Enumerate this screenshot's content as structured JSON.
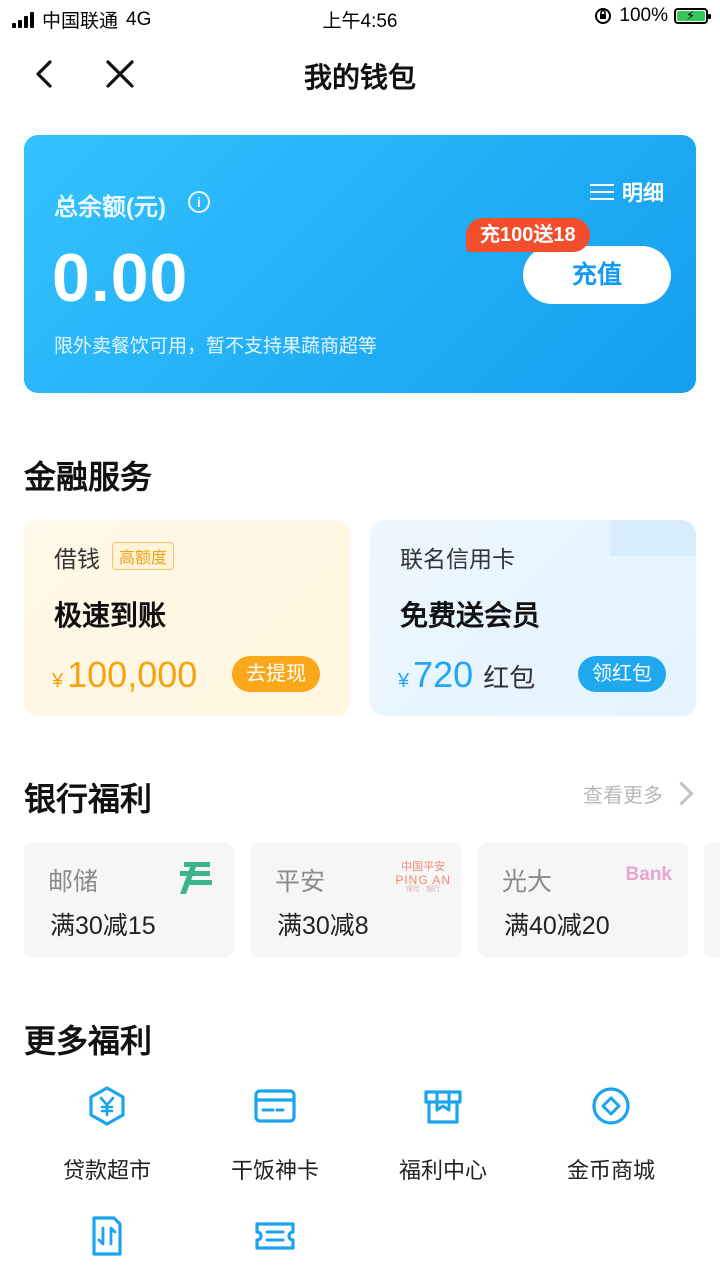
{
  "status_bar": {
    "carrier": "中国联通",
    "network": "4G",
    "time": "上午4:56",
    "battery": "100%"
  },
  "nav": {
    "title": "我的钱包"
  },
  "balance": {
    "label": "总余额(元)",
    "info_glyph": "i",
    "amount": "0.00",
    "note": "限外卖餐饮可用，暂不支持果蔬商超等",
    "detail_label": "明细",
    "promo_badge": "充100送18",
    "topup_label": "充值"
  },
  "finance": {
    "title": "金融服务",
    "loan": {
      "name": "借钱",
      "tag": "高额度",
      "headline": "极速到账",
      "currency": "¥",
      "amount": "100,000",
      "button": "去提现"
    },
    "credit_card": {
      "name": "联名信用卡",
      "headline": "免费送会员",
      "currency": "¥",
      "amount": "720",
      "suffix": "红包",
      "button": "领红包"
    }
  },
  "bank": {
    "title": "银行福利",
    "more_label": "查看更多",
    "cards": [
      {
        "name": "邮储",
        "offer": "满30减15",
        "logo": "postal-savings-logo"
      },
      {
        "name": "平安",
        "offer": "满30减8",
        "logo_line1": "中国平安",
        "logo_line2": "PING AN",
        "logo_line3": "保险 · 银行"
      },
      {
        "name": "光大",
        "offer": "满40减20",
        "logo_text": "Bank"
      }
    ]
  },
  "more_benefits": {
    "title": "更多福利",
    "items": [
      {
        "label": "贷款超市",
        "icon": "yen-hexagon-icon"
      },
      {
        "label": "干饭神卡",
        "icon": "card-icon"
      },
      {
        "label": "福利中心",
        "icon": "gift-box-icon"
      },
      {
        "label": "金币商城",
        "icon": "coin-icon"
      },
      {
        "label": "",
        "icon": "transfer-doc-icon"
      },
      {
        "label": "",
        "icon": "ticket-icon"
      }
    ]
  },
  "colors": {
    "accent_blue": "#1fa7f0",
    "loan_orange": "#f9a81c",
    "promo_red": "#f24e2b"
  }
}
